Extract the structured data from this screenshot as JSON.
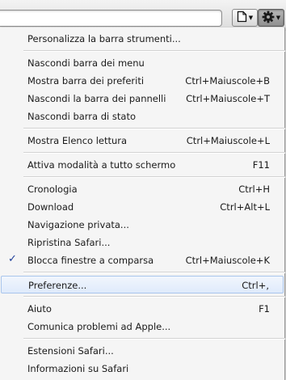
{
  "toolbar": {
    "address_value": "",
    "page_menu_icon": "page-icon",
    "settings_menu_icon": "gear-icon"
  },
  "menu": {
    "items": [
      {
        "label": "Personalizza la barra strumenti...",
        "shortcut": ""
      },
      {
        "label": "Nascondi barra dei menu",
        "shortcut": ""
      },
      {
        "label": "Mostra barra dei preferiti",
        "shortcut": "Ctrl+Maiuscole+B"
      },
      {
        "label": "Nascondi la barra dei pannelli",
        "shortcut": "Ctrl+Maiuscole+T"
      },
      {
        "label": "Nascondi barra di stato",
        "shortcut": ""
      },
      {
        "label": "Mostra Elenco lettura",
        "shortcut": "Ctrl+Maiuscole+L"
      },
      {
        "label": "Attiva modalità a tutto schermo",
        "shortcut": "F11"
      },
      {
        "label": "Cronologia",
        "shortcut": "Ctrl+H"
      },
      {
        "label": "Download",
        "shortcut": "Ctrl+Alt+L"
      },
      {
        "label": "Navigazione privata...",
        "shortcut": ""
      },
      {
        "label": "Ripristina Safari...",
        "shortcut": ""
      },
      {
        "label": "Blocca finestre a comparsa",
        "shortcut": "Ctrl+Maiuscole+K",
        "checked": true,
        "check_mark": "✓"
      },
      {
        "label": "Preferenze...",
        "shortcut": "Ctrl+,",
        "highlighted": true
      },
      {
        "label": "Aiuto",
        "shortcut": "F1"
      },
      {
        "label": "Comunica problemi ad Apple...",
        "shortcut": ""
      },
      {
        "label": "Estensioni Safari...",
        "shortcut": ""
      },
      {
        "label": "Informazioni su Safari",
        "shortcut": ""
      }
    ]
  },
  "colors": {
    "highlight_border": "#a9c5ec",
    "highlight_fill": "#dfeafb",
    "check_mark": "#1f3f99",
    "menu_background": "#f5f5f5"
  }
}
